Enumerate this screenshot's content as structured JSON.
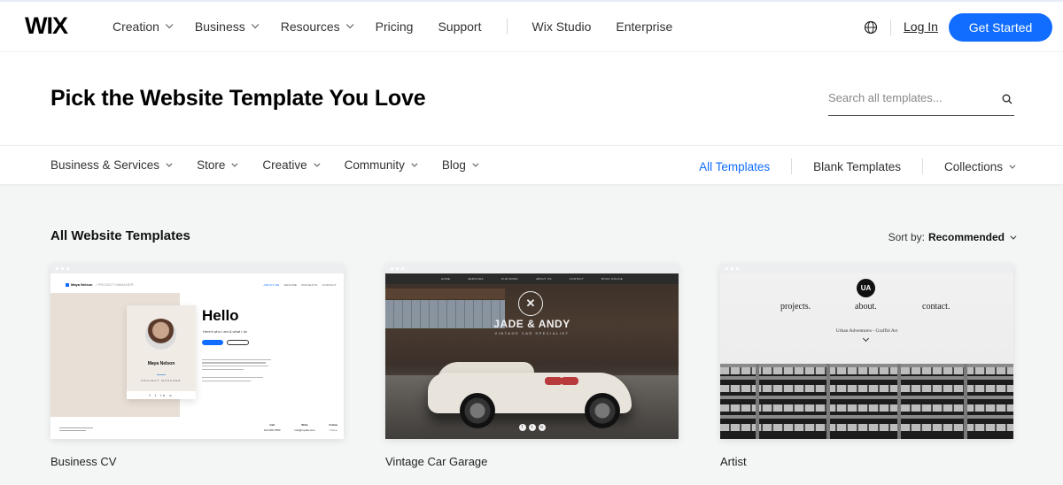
{
  "header": {
    "logo": "WIX",
    "nav": [
      {
        "label": "Creation",
        "has_dropdown": true
      },
      {
        "label": "Business",
        "has_dropdown": true
      },
      {
        "label": "Resources",
        "has_dropdown": true
      },
      {
        "label": "Pricing",
        "has_dropdown": false
      },
      {
        "label": "Support",
        "has_dropdown": false
      },
      {
        "label": "Wix Studio",
        "has_dropdown": false
      },
      {
        "label": "Enterprise",
        "has_dropdown": false
      }
    ],
    "language_icon": "globe-icon",
    "login_label": "Log In",
    "cta_label": "Get Started",
    "cta_color": "#116dff"
  },
  "hero": {
    "title": "Pick the Website Template You Love",
    "search": {
      "placeholder": "Search all templates...",
      "value": "",
      "icon": "search-icon"
    }
  },
  "categories": {
    "left": [
      {
        "label": "Business & Services"
      },
      {
        "label": "Store"
      },
      {
        "label": "Creative"
      },
      {
        "label": "Community"
      },
      {
        "label": "Blog"
      }
    ],
    "right": [
      {
        "label": "All Templates",
        "active": true
      },
      {
        "label": "Blank Templates",
        "active": false
      },
      {
        "label": "Collections",
        "has_dropdown": true
      }
    ],
    "active_color": "#116dff"
  },
  "section": {
    "title": "All Website Templates",
    "sort_label": "Sort by:",
    "sort_value": "Recommended"
  },
  "templates": [
    {
      "name": "Business CV",
      "preview": {
        "brand": "Maya Nelson",
        "brand_sub": "/ PROJECT MANAGER",
        "nav": [
          "ABOUT ME",
          "RESUME",
          "PROJECTS",
          "CONTACT"
        ],
        "headline": "Hello",
        "tagline": "Here's who I am & what I do",
        "person_name": "Maya Nelson",
        "role": "PROJECT MANAGER",
        "buttons": [
          "RESUME",
          "PROJECTS"
        ],
        "footer_cols": [
          {
            "title": "Call",
            "value": "123-456-7890"
          },
          {
            "title": "Write",
            "value": "info@mysite.com"
          },
          {
            "title": "Follow",
            "value": "f t in o"
          }
        ]
      }
    },
    {
      "name": "Vintage Car Garage",
      "preview": {
        "nav": [
          "HOME",
          "SERVICES",
          "OUR WORK",
          "ABOUT US",
          "CONTACT",
          "BOOK ONLINE"
        ],
        "brand": "JADE & ANDY",
        "brand_sub": "VINTAGE CAR SPECIALIST",
        "socials": [
          "f",
          "t",
          "o"
        ]
      }
    },
    {
      "name": "Artist",
      "preview": {
        "logo": "UA",
        "links": [
          "projects.",
          "about.",
          "contact."
        ],
        "tagline": "Urban Adventures - Graffiti Art"
      }
    }
  ]
}
